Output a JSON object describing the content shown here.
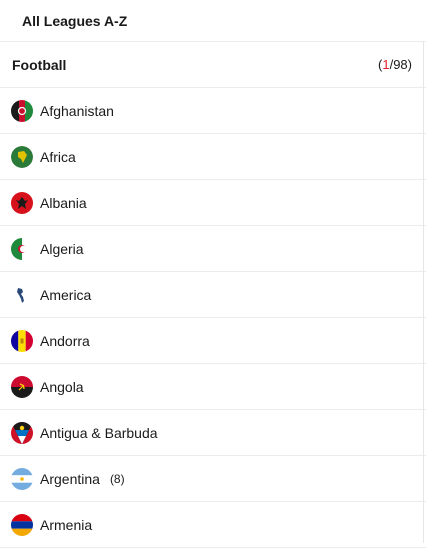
{
  "header": {
    "title": "All Leagues A-Z"
  },
  "sport": {
    "name": "Football",
    "count_open": "(",
    "count_highlight": "1",
    "count_rest": "/98)"
  },
  "countries": [
    {
      "label": "Afghanistan",
      "icon": "afghanistan-flag-icon",
      "sub": ""
    },
    {
      "label": "Africa",
      "icon": "africa-globe-icon",
      "sub": ""
    },
    {
      "label": "Albania",
      "icon": "albania-flag-icon",
      "sub": ""
    },
    {
      "label": "Algeria",
      "icon": "algeria-flag-icon",
      "sub": ""
    },
    {
      "label": "America",
      "icon": "america-map-icon",
      "sub": ""
    },
    {
      "label": "Andorra",
      "icon": "andorra-flag-icon",
      "sub": ""
    },
    {
      "label": "Angola",
      "icon": "angola-flag-icon",
      "sub": ""
    },
    {
      "label": "Antigua & Barbuda",
      "icon": "antigua-barbuda-flag-icon",
      "sub": ""
    },
    {
      "label": "Argentina",
      "icon": "argentina-flag-icon",
      "sub": "(8)"
    },
    {
      "label": "Armenia",
      "icon": "armenia-flag-icon",
      "sub": ""
    }
  ],
  "colors": {
    "accent": "#e0222c",
    "divider": "#ececec"
  }
}
